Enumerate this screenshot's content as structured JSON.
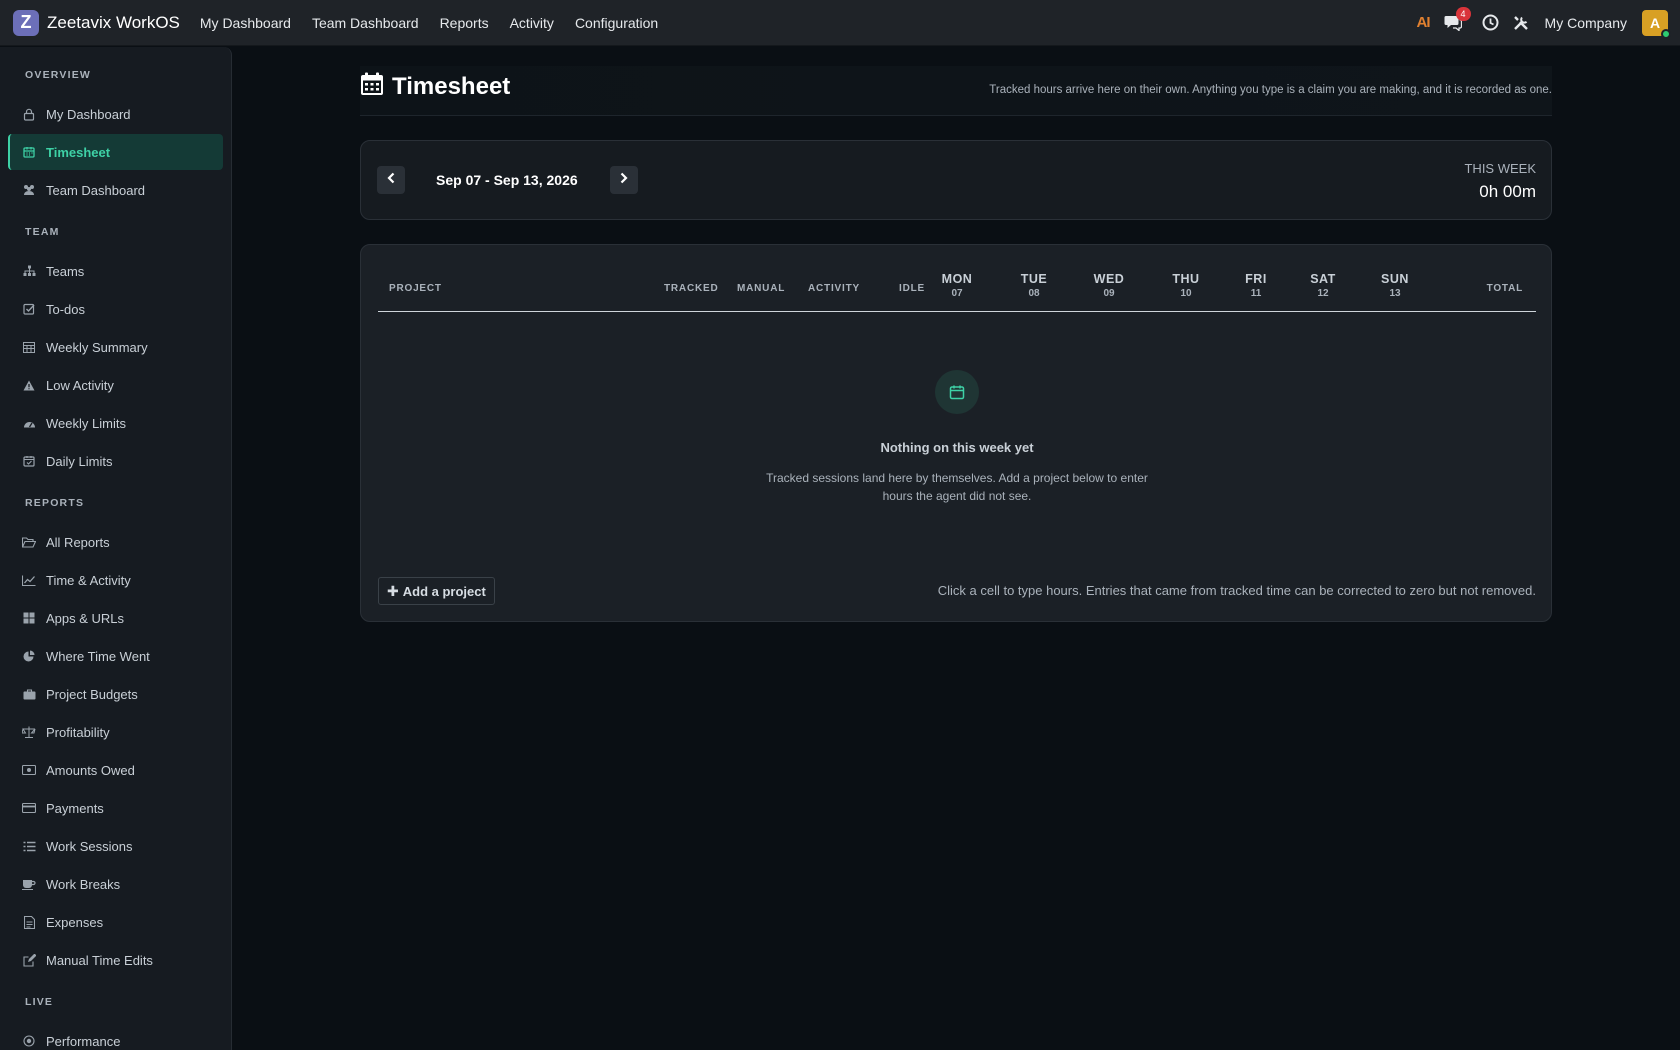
{
  "brand": {
    "logo_letter": "Z",
    "name": "Zeetavix WorkOS"
  },
  "topnav": [
    "My Dashboard",
    "Team Dashboard",
    "Reports",
    "Activity",
    "Configuration"
  ],
  "topright": {
    "ai_label": "AI",
    "chat_badge": "4",
    "company": "My Company",
    "avatar_letter": "A"
  },
  "sidebar": {
    "sections": [
      {
        "title": "OVERVIEW",
        "items": [
          {
            "label": "My Dashboard",
            "icon": "lock-icon"
          },
          {
            "label": "Timesheet",
            "icon": "calendar-icon",
            "active": true
          },
          {
            "label": "Team Dashboard",
            "icon": "users-icon"
          }
        ]
      },
      {
        "title": "TEAM",
        "items": [
          {
            "label": "Teams",
            "icon": "sitemap-icon"
          },
          {
            "label": "To-dos",
            "icon": "checkbox-icon"
          },
          {
            "label": "Weekly Summary",
            "icon": "table-icon"
          },
          {
            "label": "Low Activity",
            "icon": "warning-icon"
          },
          {
            "label": "Weekly Limits",
            "icon": "gauge-icon"
          },
          {
            "label": "Daily Limits",
            "icon": "calendar-check-icon"
          }
        ]
      },
      {
        "title": "REPORTS",
        "items": [
          {
            "label": "All Reports",
            "icon": "folder-open-icon"
          },
          {
            "label": "Time & Activity",
            "icon": "line-chart-icon"
          },
          {
            "label": "Apps & URLs",
            "icon": "grid-icon"
          },
          {
            "label": "Where Time Went",
            "icon": "pie-chart-icon"
          },
          {
            "label": "Project Budgets",
            "icon": "briefcase-icon"
          },
          {
            "label": "Profitability",
            "icon": "scale-icon"
          },
          {
            "label": "Amounts Owed",
            "icon": "money-icon"
          },
          {
            "label": "Payments",
            "icon": "credit-card-icon"
          },
          {
            "label": "Work Sessions",
            "icon": "list-icon"
          },
          {
            "label": "Work Breaks",
            "icon": "coffee-icon"
          },
          {
            "label": "Expenses",
            "icon": "receipt-icon"
          },
          {
            "label": "Manual Time Edits",
            "icon": "edit-icon"
          }
        ]
      },
      {
        "title": "LIVE",
        "items": [
          {
            "label": "Performance",
            "icon": "target-icon"
          }
        ]
      }
    ]
  },
  "page": {
    "title": "Timesheet",
    "subtitle": "Tracked hours arrive here on their own. Anything you type is a claim you are making, and it is recorded as one."
  },
  "week": {
    "range": "Sep 07 - Sep 13, 2026",
    "this_week_label": "THIS WEEK",
    "this_week_value": "0h 00m"
  },
  "table": {
    "headers": {
      "project": "PROJECT",
      "tracked": "TRACKED",
      "manual": "MANUAL",
      "activity": "ACTIVITY",
      "idle": "IDLE",
      "total": "TOTAL"
    },
    "days": [
      {
        "name": "MON",
        "date": "07"
      },
      {
        "name": "TUE",
        "date": "08"
      },
      {
        "name": "WED",
        "date": "09"
      },
      {
        "name": "THU",
        "date": "10"
      },
      {
        "name": "FRI",
        "date": "11"
      },
      {
        "name": "SAT",
        "date": "12"
      },
      {
        "name": "SUN",
        "date": "13"
      }
    ],
    "empty_title": "Nothing on this week yet",
    "empty_text": "Tracked sessions land here by themselves. Add a project below to enter hours the agent did not see.",
    "add_label": "Add a project",
    "hint": "Click a cell to type hours. Entries that came from tracked time can be corrected to zero but not removed."
  },
  "colors": {
    "accent": "#3ed1a6",
    "active_bg": "#143a36",
    "badge": "#d9343a",
    "avatar": "#d8a024"
  }
}
